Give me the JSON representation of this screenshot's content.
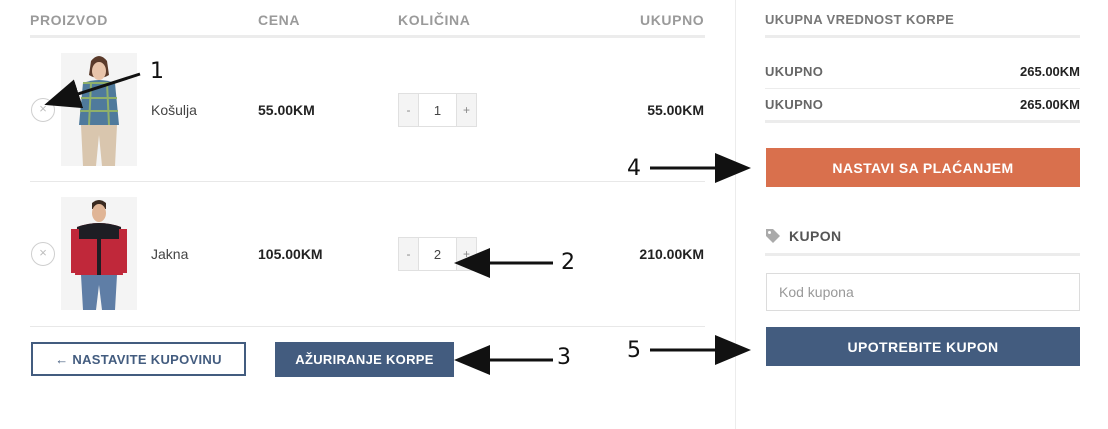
{
  "table": {
    "headers": {
      "product": "PROIZVOD",
      "price": "CENA",
      "quantity": "KOLIČINA",
      "total": "UKUPNO"
    },
    "rows": [
      {
        "remove": "×",
        "name": "Košulja",
        "price": "55.00KM",
        "qty_minus": "-",
        "quantity": "1",
        "qty_plus": "+",
        "total": "55.00KM"
      },
      {
        "remove": "×",
        "name": "Jakna",
        "price": "105.00KM",
        "qty_minus": "-",
        "quantity": "2",
        "qty_plus": "+",
        "total": "210.00KM"
      }
    ]
  },
  "actions": {
    "continue_shopping": "← NASTAVITE KUPOVINU",
    "update_cart": "AŽURIRANJE KORPE"
  },
  "sidebar": {
    "title": "UKUPNA VREDNOST KORPE",
    "summary": [
      {
        "label": "UKUPNO",
        "value": "265.00KM"
      },
      {
        "label": "UKUPNO",
        "value": "265.00KM"
      }
    ],
    "checkout_label": "NASTAVI SA PLAĆANJEM",
    "coupon_title": "KUPON",
    "coupon_placeholder": "Kod kupona",
    "coupon_value": "",
    "apply_coupon_label": "UPOTREBITE KUPON"
  },
  "annotations": [
    "1",
    "2",
    "3",
    "4",
    "5"
  ],
  "colors": {
    "accent_blue": "#435c7f",
    "checkout_orange": "#d9704d",
    "shirt_plaid_blue": "#4f7a9c",
    "jacket_red": "#c0283a"
  },
  "icons": {
    "remove": "close-icon",
    "coupon": "tag-icon"
  }
}
